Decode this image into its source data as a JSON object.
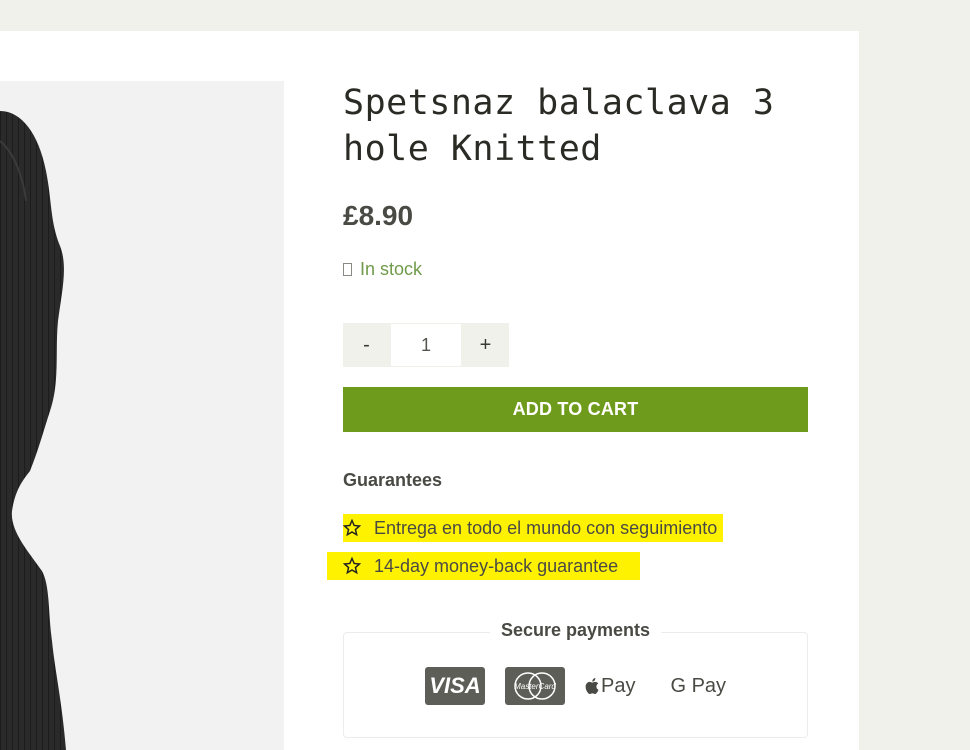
{
  "product": {
    "title": "Spetsnaz balaclava 3 hole Knitted",
    "price": "£8.90",
    "stock_status": "In stock",
    "image_icon": "balaclava-image"
  },
  "quantity": {
    "decrease_label": "-",
    "value": "1",
    "increase_label": "+"
  },
  "cart": {
    "add_label": "ADD TO CART"
  },
  "guarantees": {
    "heading": "Guarantees",
    "items": [
      "Entrega en todo el mundo con seguimiento",
      "14-day money-back guarantee"
    ],
    "icon": "star-icon",
    "highlight_color": "#fff200"
  },
  "payments": {
    "title": "Secure payments",
    "visa": "VISA",
    "mastercard": "MasterCard",
    "apple_pay": "Pay",
    "google_pay": "G Pay"
  },
  "colors": {
    "accent": "#6f9b1d",
    "stock": "#6f9a4a",
    "text": "#4a4a44"
  }
}
